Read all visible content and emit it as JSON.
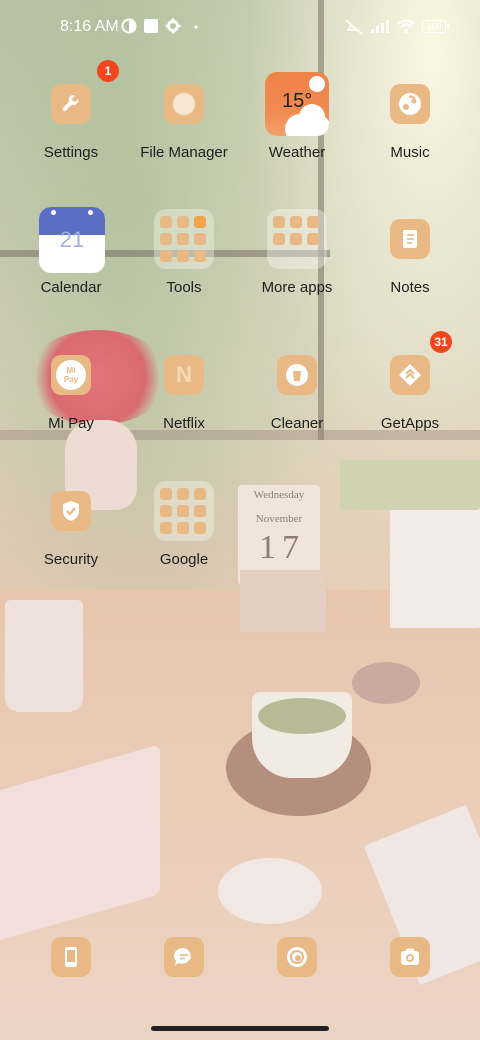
{
  "status_bar": {
    "time": "8:16 AM",
    "battery": "100",
    "icons": [
      "circle-half-icon",
      "square-icon",
      "gear-icon",
      "more-dots-icon",
      "mute-icon",
      "signal-icon",
      "wifi-icon",
      "battery-icon"
    ]
  },
  "apps": [
    {
      "label": "Settings",
      "icon": "wrench-icon",
      "badge": "1"
    },
    {
      "label": "File Manager",
      "icon": "folder-icon"
    },
    {
      "label": "Weather",
      "icon": "weather-icon",
      "temperature": "15°"
    },
    {
      "label": "Music",
      "icon": "music-icon"
    },
    {
      "label": "Calendar",
      "icon": "calendar-icon",
      "date": "21"
    },
    {
      "label": "Tools",
      "icon": "folder-grid-icon"
    },
    {
      "label": "More apps",
      "icon": "folder-grid-icon"
    },
    {
      "label": "Notes",
      "icon": "notebook-icon"
    },
    {
      "label": "Mi Pay",
      "icon": "mi-pay-icon",
      "icon_text": "Mi Pay"
    },
    {
      "label": "Netflix",
      "icon": "netflix-icon",
      "icon_text": "N"
    },
    {
      "label": "Cleaner",
      "icon": "trash-icon"
    },
    {
      "label": "GetApps",
      "icon": "getapps-icon",
      "badge": "31"
    },
    {
      "label": "Security",
      "icon": "shield-icon"
    },
    {
      "label": "Google",
      "icon": "folder-grid-icon"
    }
  ],
  "dock": [
    {
      "name": "phone",
      "icon": "phone-icon"
    },
    {
      "name": "messages",
      "icon": "message-icon"
    },
    {
      "name": "browser",
      "icon": "browser-icon"
    },
    {
      "name": "camera",
      "icon": "camera-icon"
    }
  ],
  "wallpaper": {
    "calendar_day": "Wednesday",
    "calendar_month": "November",
    "calendar_digits": [
      "1",
      "7"
    ]
  },
  "colors": {
    "icon_tile": "#e9b985",
    "badge": "#f0471e",
    "label": "#1e1e1e"
  }
}
